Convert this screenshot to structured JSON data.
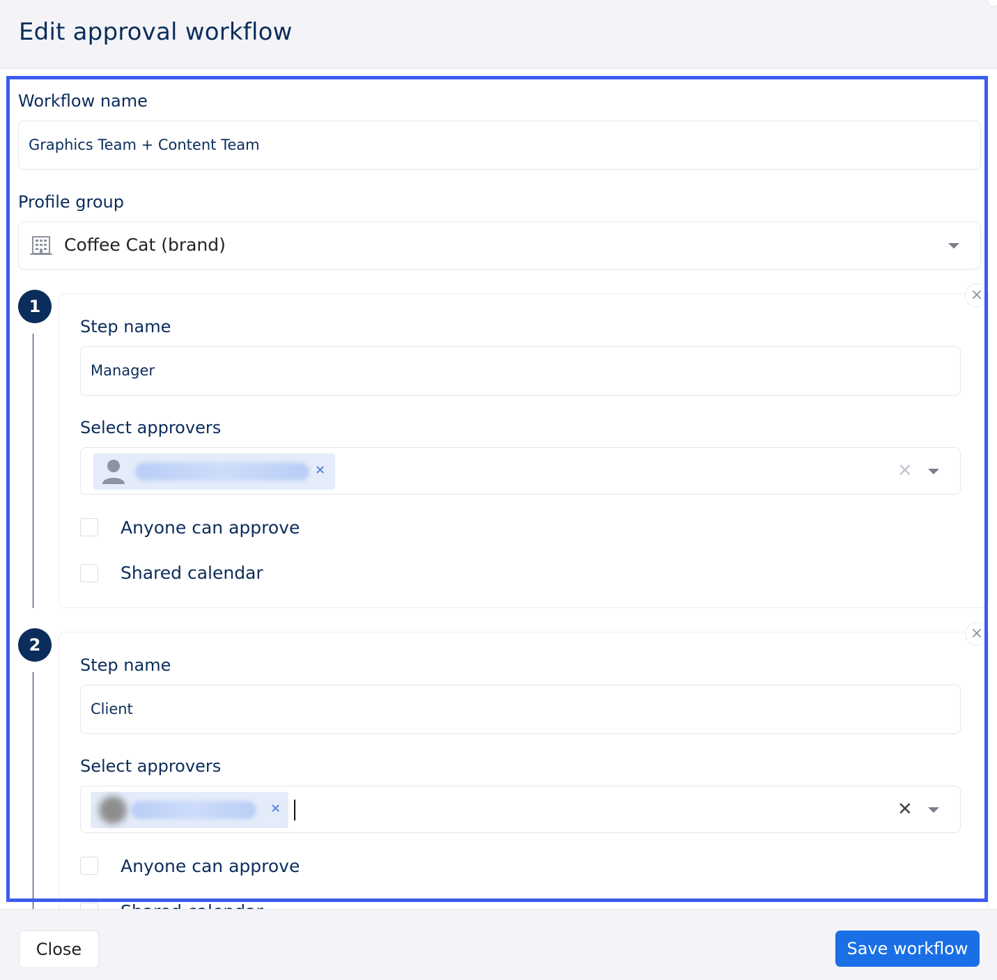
{
  "dialog": {
    "title": "Edit approval workflow"
  },
  "form": {
    "workflow_name_label": "Workflow name",
    "workflow_name_value": "Graphics Team + Content Team",
    "profile_group_label": "Profile group",
    "profile_group_value": "Coffee Cat (brand)",
    "profile_group_icon": "building-icon"
  },
  "steps": [
    {
      "number": "1",
      "name_label": "Step name",
      "name_value": "Manager",
      "approvers_label": "Select approvers",
      "approver_chip_icon": "user-avatar-icon",
      "anyone_can_approve_label": "Anyone can approve",
      "shared_calendar_label": "Shared calendar"
    },
    {
      "number": "2",
      "name_label": "Step name",
      "name_value": "Client",
      "approvers_label": "Select approvers",
      "anyone_can_approve_label": "Anyone can approve",
      "shared_calendar_label": "Shared calendar"
    }
  ],
  "footer": {
    "close_label": "Close",
    "save_label": "Save workflow"
  },
  "colors": {
    "primary": "#0b2d5b",
    "accent": "#1a6fe6",
    "highlight": "#3c5bf0"
  }
}
